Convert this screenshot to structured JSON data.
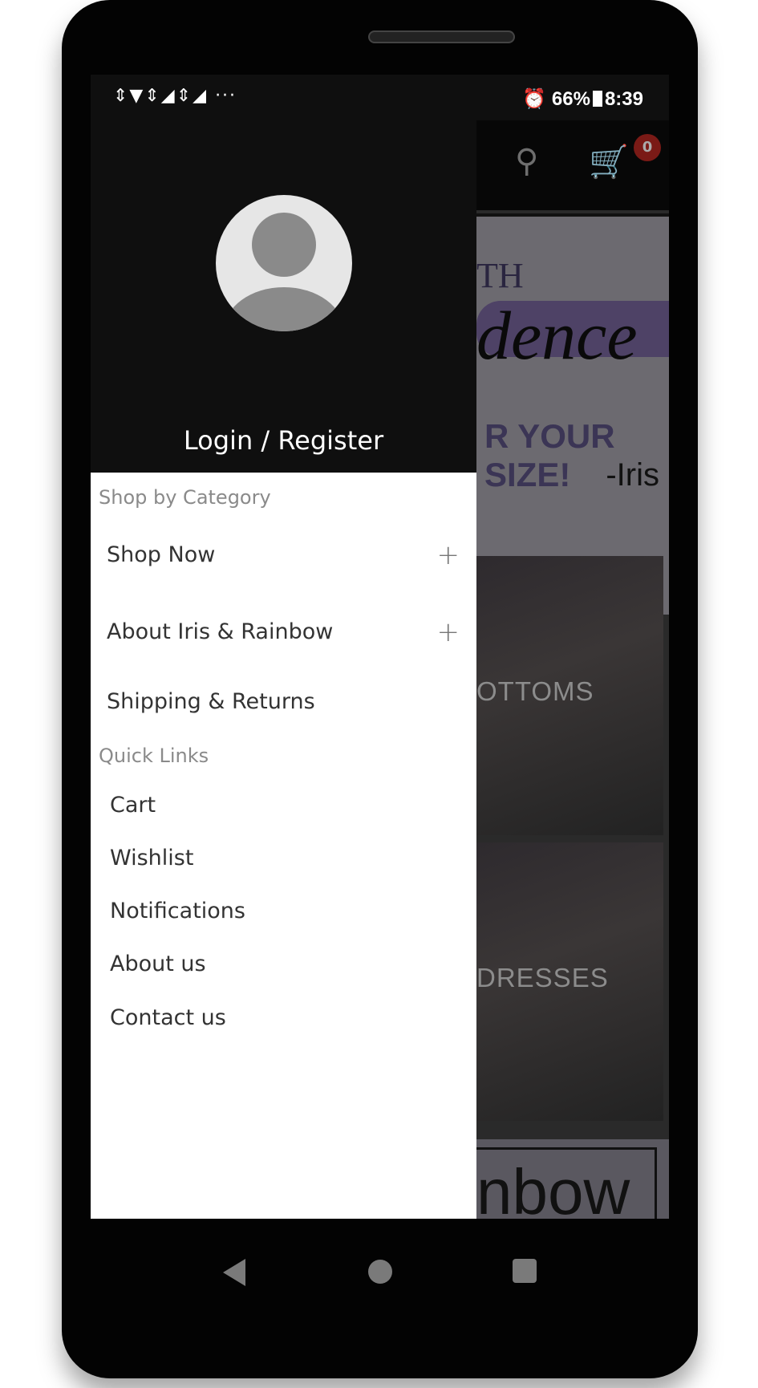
{
  "status_bar": {
    "icons": [
      "data-arrows-icon",
      "wifi-icon",
      "signal-icon",
      "signal-icon",
      "more-icon"
    ],
    "more": "···",
    "alarm_icon": "alarm-icon",
    "battery": "66%",
    "battery_icon": "battery-charging-icon",
    "time": "8:39"
  },
  "toolbar": {
    "search_icon": "search-icon",
    "cart_icon": "cart-icon",
    "cart_count": "0",
    "badge_color": "#7a1a16"
  },
  "background": {
    "banner_text_1": "TH",
    "banner_text_2": "dence",
    "banner_text_3": "R YOUR SIZE!",
    "banner_text_4": "-Iris",
    "tile_1": "OTTOMS",
    "tile_2": "DRESSES",
    "banner_bottom": "nbow"
  },
  "drawer": {
    "login_label": "Login / Register",
    "shop_section": "Shop by Category",
    "categories": [
      {
        "label": "Shop Now",
        "expandable": true
      },
      {
        "label": "About Iris & Rainbow",
        "expandable": true
      },
      {
        "label": "Shipping & Returns",
        "expandable": false
      }
    ],
    "expand_glyph": "+",
    "quick_section": "Quick Links",
    "quick_links": [
      "Cart",
      "Wishlist",
      "Notifications",
      "About us",
      "Contact us"
    ]
  },
  "nav": {
    "back": "back-icon",
    "home": "home-icon",
    "recents": "recents-icon"
  }
}
